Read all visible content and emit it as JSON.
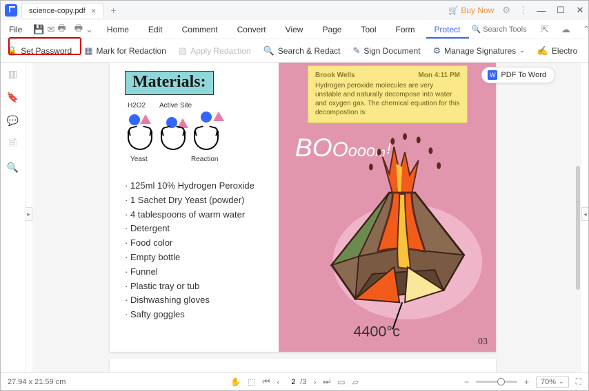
{
  "tab_title": "science-copy.pdf",
  "buy_now": "Buy Now",
  "menu_file": "File",
  "menus": [
    "Home",
    "Edit",
    "Comment",
    "Convert",
    "View",
    "Page",
    "Tool",
    "Form",
    "Protect"
  ],
  "active_menu": "Protect",
  "search_placeholder": "Search Tools",
  "tools": {
    "set_password": "Set Password",
    "mark_redaction": "Mark for Redaction",
    "apply_redaction": "Apply Redaction",
    "search_redact": "Search & Redact",
    "sign_document": "Sign Document",
    "manage_signatures": "Manage Signatures",
    "electronic": "Electro"
  },
  "materials_heading": "Materials:",
  "diagram_labels": {
    "h2o2": "H2O2",
    "active": "Active Site",
    "yeast": "Yeast",
    "reaction": "Reaction"
  },
  "materials_list": [
    "125ml 10% Hydrogen Peroxide",
    "1 Sachet Dry Yeast (powder)",
    "4 tablespoons of warm water",
    "Detergent",
    "Food color",
    "Empty bottle",
    "Funnel",
    "Plastic tray or tub",
    "Dishwashing gloves",
    "Safty goggles"
  ],
  "note": {
    "author": "Brook Wells",
    "time": "Mon 4:11 PM",
    "body": "Hydrogen peroxide molecules are very unstable and naturally decompose into water and oxygen gas. The chemical equation for this decompostion is:"
  },
  "boom_text": "BOOooom!",
  "temp_text": "4400°c",
  "page_num": "03",
  "pdf_to_word": "PDF To Word",
  "status": {
    "dims": "27.94 x 21.59 cm",
    "page_current": "2",
    "page_total": "/3",
    "zoom": "70%"
  }
}
